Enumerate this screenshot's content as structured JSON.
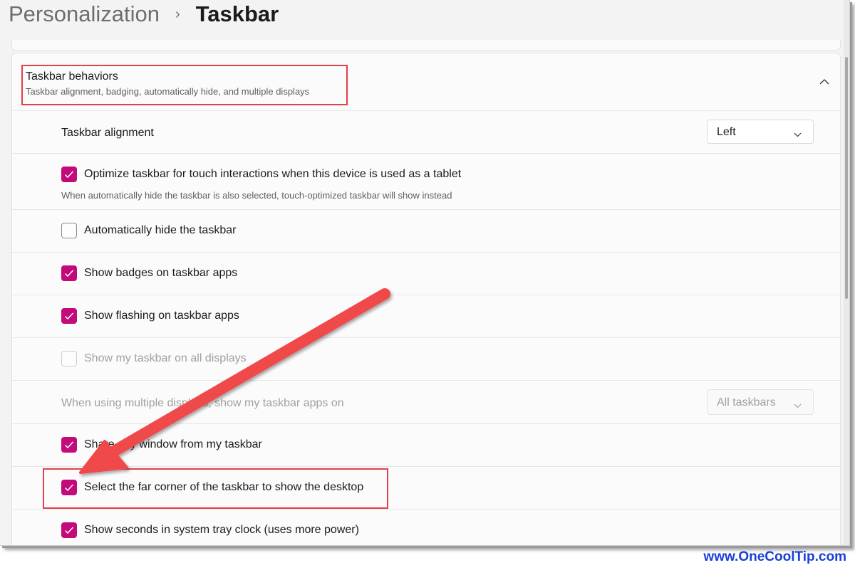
{
  "breadcrumb": {
    "parent": "Personalization",
    "separator": "›",
    "current": "Taskbar"
  },
  "section": {
    "title": "Taskbar behaviors",
    "subtitle": "Taskbar alignment, badging, automatically hide, and multiple displays",
    "chevron_icon": "chevron-up-icon"
  },
  "alignment": {
    "label": "Taskbar alignment",
    "value": "Left"
  },
  "settings": {
    "touch": {
      "label": "Optimize taskbar for touch interactions when this device is used as a tablet",
      "description": "When automatically hide the taskbar is also selected, touch-optimized taskbar will show instead",
      "checked": true
    },
    "autohide": {
      "label": "Automatically hide the taskbar",
      "checked": false
    },
    "badges": {
      "label": "Show badges on taskbar apps",
      "checked": true
    },
    "flashing": {
      "label": "Show flashing on taskbar apps",
      "checked": true
    },
    "all_displays": {
      "label": "Show my taskbar on all displays",
      "checked": false,
      "disabled": true
    },
    "share": {
      "label": "Share any window from my taskbar",
      "checked": true
    },
    "far_corner": {
      "label": "Select the far corner of the taskbar to show the desktop",
      "checked": true
    },
    "seconds": {
      "label": "Show seconds in system tray clock (uses more power)",
      "checked": true
    }
  },
  "multi_display": {
    "label": "When using multiple displays, show my taskbar apps on",
    "value": "All taskbars",
    "disabled": true
  },
  "colors": {
    "accent": "#c20a7a",
    "highlight_box": "#e0404a",
    "arrow": "#f04848",
    "watermark": "#1a3ed8"
  },
  "watermark": "www.OneCoolTip.com"
}
